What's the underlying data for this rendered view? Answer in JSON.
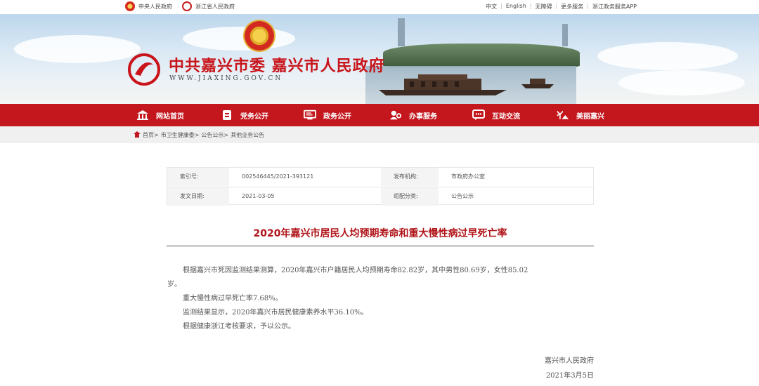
{
  "topbar": {
    "links_left": [
      "中央人民政府",
      "浙江省人民政府"
    ],
    "links_right": [
      "中文",
      "English",
      "无障碍",
      "更多服务",
      "浙江政务服务APP"
    ]
  },
  "header": {
    "title": "中共嘉兴市委 嘉兴市人民政府",
    "url": "WWW.JIAXING.GOV.CN"
  },
  "nav": [
    {
      "label": "网站首页",
      "icon": "home-icon"
    },
    {
      "label": "党务公开",
      "icon": "document-icon"
    },
    {
      "label": "政务公开",
      "icon": "monitor-icon"
    },
    {
      "label": "办事服务",
      "icon": "service-icon"
    },
    {
      "label": "互动交流",
      "icon": "chat-icon"
    },
    {
      "label": "美丽嘉兴",
      "icon": "scenery-icon"
    }
  ],
  "breadcrumb": [
    "首页",
    "市卫生健康委",
    "公告公示",
    "其他业务公告"
  ],
  "meta": {
    "index_label": "索引号:",
    "index_value": "002546445/2021-393121",
    "publisher_label": "发布机构:",
    "publisher_value": "市政府办公室",
    "date_label": "发文日期:",
    "date_value": "2021-03-05",
    "category_label": "组配分类:",
    "category_value": "公告公示"
  },
  "article": {
    "title": "2020年嘉兴市居民人均预期寿命和重大慢性病过早死亡率",
    "p1a": "根据嘉兴市死因监测结果测算，2020年嘉兴市户籍居民人均预期寿命82.82岁，其中男性80.69岁，女性85.02",
    "p1b": "岁。",
    "p2": "重大慢性病过早死亡率7.68%。",
    "p3": "监测结果显示，2020年嘉兴市居民健康素养水平36.10%。",
    "p4": "根据健康浙江考核要求，予以公示。",
    "signature": "嘉兴市人民政府",
    "date": "2021年3月5日"
  }
}
